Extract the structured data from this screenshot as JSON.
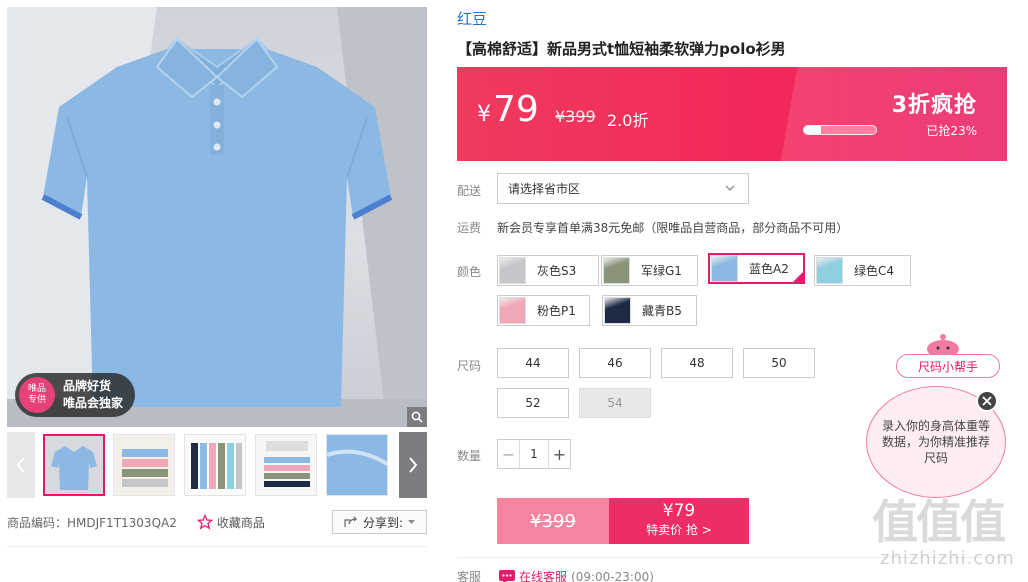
{
  "gallery": {
    "badge_circle": "唯品\n专供",
    "badge_line1": "品牌好货",
    "badge_line2": "唯品会独家",
    "product_code": "商品编码：HMDJF1T1303QA2",
    "favorite_label": "收藏商品",
    "share_label": "分享到:"
  },
  "product": {
    "brand": "红豆",
    "title": "【高棉舒适】新品男式t恤短袖柔软弹力polo衫男"
  },
  "price": {
    "currency": "¥",
    "current": "79",
    "original": "¥399",
    "discount": "2.0折",
    "flash_label": "3折疯抢",
    "sold_text": "已抢23%",
    "sold_progress": 0.23
  },
  "shipping": {
    "label": "配送",
    "select_value": "请选择省市区"
  },
  "freight": {
    "label": "运费",
    "text": "新会员专享首单满38元免邮（限唯品自营商品，部分商品不可用）"
  },
  "colors": {
    "label": "颜色",
    "options": [
      {
        "name": "灰色S3",
        "swatch": "#c4c6ca"
      },
      {
        "name": "军绿G1",
        "swatch": "#8a9479"
      },
      {
        "name": "蓝色A2",
        "swatch": "#8cb9e3"
      },
      {
        "name": "绿色C4",
        "swatch": "#8fcde0"
      },
      {
        "name": "粉色P1",
        "swatch": "#f0a7b8"
      },
      {
        "name": "藏青B5",
        "swatch": "#1f2b45"
      }
    ],
    "selected": "蓝色A2"
  },
  "sizes": {
    "label": "尺码",
    "options": [
      "44",
      "46",
      "48",
      "50",
      "52",
      "54"
    ],
    "disabled": [
      "54"
    ]
  },
  "quantity": {
    "label": "数量",
    "value": "1",
    "minus": "−",
    "plus": "+"
  },
  "buy": {
    "old_price": "¥399",
    "new_price": "¥79",
    "action_label": "特卖价 抢 >"
  },
  "service": {
    "label": "客服",
    "chat_label": "在线客服",
    "hours": "(09:00-23:00)"
  },
  "size_helper": {
    "pill_label": "尺码小帮手",
    "bubble_text": "录入你的身高体重等数据，为你精准推荐尺码"
  },
  "watermark": {
    "chars": "值值值",
    "url": "zhizhizhi.com"
  },
  "colors_theme": {
    "accent": "#e31b6a",
    "banner": "#f2275a",
    "brand_link": "#2b6fbf",
    "shirt": "#8cb9e3"
  }
}
